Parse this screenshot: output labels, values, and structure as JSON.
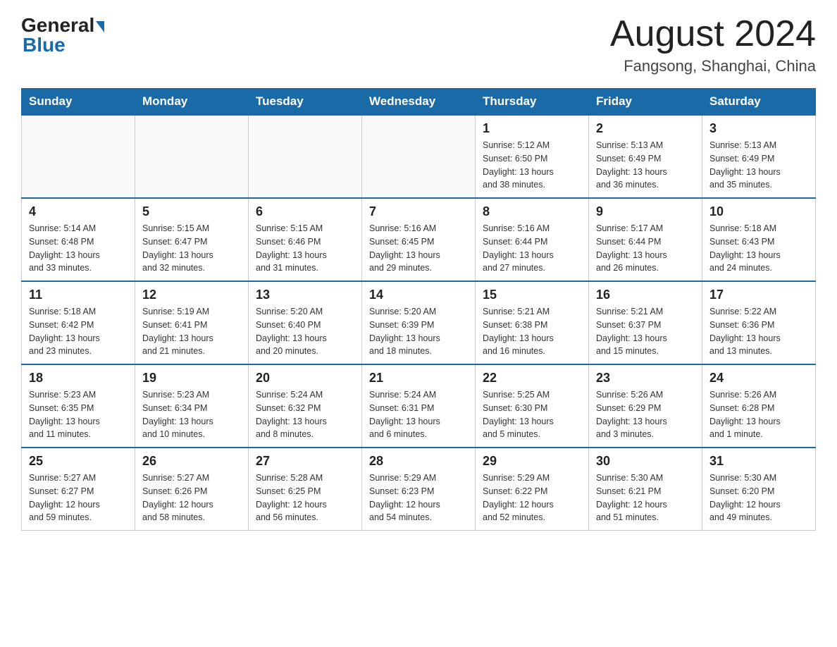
{
  "header": {
    "logo_general": "General",
    "logo_blue": "Blue",
    "month_title": "August 2024",
    "location": "Fangsong, Shanghai, China"
  },
  "days_of_week": [
    "Sunday",
    "Monday",
    "Tuesday",
    "Wednesday",
    "Thursday",
    "Friday",
    "Saturday"
  ],
  "weeks": [
    [
      {
        "day": "",
        "info": ""
      },
      {
        "day": "",
        "info": ""
      },
      {
        "day": "",
        "info": ""
      },
      {
        "day": "",
        "info": ""
      },
      {
        "day": "1",
        "info": "Sunrise: 5:12 AM\nSunset: 6:50 PM\nDaylight: 13 hours\nand 38 minutes."
      },
      {
        "day": "2",
        "info": "Sunrise: 5:13 AM\nSunset: 6:49 PM\nDaylight: 13 hours\nand 36 minutes."
      },
      {
        "day": "3",
        "info": "Sunrise: 5:13 AM\nSunset: 6:49 PM\nDaylight: 13 hours\nand 35 minutes."
      }
    ],
    [
      {
        "day": "4",
        "info": "Sunrise: 5:14 AM\nSunset: 6:48 PM\nDaylight: 13 hours\nand 33 minutes."
      },
      {
        "day": "5",
        "info": "Sunrise: 5:15 AM\nSunset: 6:47 PM\nDaylight: 13 hours\nand 32 minutes."
      },
      {
        "day": "6",
        "info": "Sunrise: 5:15 AM\nSunset: 6:46 PM\nDaylight: 13 hours\nand 31 minutes."
      },
      {
        "day": "7",
        "info": "Sunrise: 5:16 AM\nSunset: 6:45 PM\nDaylight: 13 hours\nand 29 minutes."
      },
      {
        "day": "8",
        "info": "Sunrise: 5:16 AM\nSunset: 6:44 PM\nDaylight: 13 hours\nand 27 minutes."
      },
      {
        "day": "9",
        "info": "Sunrise: 5:17 AM\nSunset: 6:44 PM\nDaylight: 13 hours\nand 26 minutes."
      },
      {
        "day": "10",
        "info": "Sunrise: 5:18 AM\nSunset: 6:43 PM\nDaylight: 13 hours\nand 24 minutes."
      }
    ],
    [
      {
        "day": "11",
        "info": "Sunrise: 5:18 AM\nSunset: 6:42 PM\nDaylight: 13 hours\nand 23 minutes."
      },
      {
        "day": "12",
        "info": "Sunrise: 5:19 AM\nSunset: 6:41 PM\nDaylight: 13 hours\nand 21 minutes."
      },
      {
        "day": "13",
        "info": "Sunrise: 5:20 AM\nSunset: 6:40 PM\nDaylight: 13 hours\nand 20 minutes."
      },
      {
        "day": "14",
        "info": "Sunrise: 5:20 AM\nSunset: 6:39 PM\nDaylight: 13 hours\nand 18 minutes."
      },
      {
        "day": "15",
        "info": "Sunrise: 5:21 AM\nSunset: 6:38 PM\nDaylight: 13 hours\nand 16 minutes."
      },
      {
        "day": "16",
        "info": "Sunrise: 5:21 AM\nSunset: 6:37 PM\nDaylight: 13 hours\nand 15 minutes."
      },
      {
        "day": "17",
        "info": "Sunrise: 5:22 AM\nSunset: 6:36 PM\nDaylight: 13 hours\nand 13 minutes."
      }
    ],
    [
      {
        "day": "18",
        "info": "Sunrise: 5:23 AM\nSunset: 6:35 PM\nDaylight: 13 hours\nand 11 minutes."
      },
      {
        "day": "19",
        "info": "Sunrise: 5:23 AM\nSunset: 6:34 PM\nDaylight: 13 hours\nand 10 minutes."
      },
      {
        "day": "20",
        "info": "Sunrise: 5:24 AM\nSunset: 6:32 PM\nDaylight: 13 hours\nand 8 minutes."
      },
      {
        "day": "21",
        "info": "Sunrise: 5:24 AM\nSunset: 6:31 PM\nDaylight: 13 hours\nand 6 minutes."
      },
      {
        "day": "22",
        "info": "Sunrise: 5:25 AM\nSunset: 6:30 PM\nDaylight: 13 hours\nand 5 minutes."
      },
      {
        "day": "23",
        "info": "Sunrise: 5:26 AM\nSunset: 6:29 PM\nDaylight: 13 hours\nand 3 minutes."
      },
      {
        "day": "24",
        "info": "Sunrise: 5:26 AM\nSunset: 6:28 PM\nDaylight: 13 hours\nand 1 minute."
      }
    ],
    [
      {
        "day": "25",
        "info": "Sunrise: 5:27 AM\nSunset: 6:27 PM\nDaylight: 12 hours\nand 59 minutes."
      },
      {
        "day": "26",
        "info": "Sunrise: 5:27 AM\nSunset: 6:26 PM\nDaylight: 12 hours\nand 58 minutes."
      },
      {
        "day": "27",
        "info": "Sunrise: 5:28 AM\nSunset: 6:25 PM\nDaylight: 12 hours\nand 56 minutes."
      },
      {
        "day": "28",
        "info": "Sunrise: 5:29 AM\nSunset: 6:23 PM\nDaylight: 12 hours\nand 54 minutes."
      },
      {
        "day": "29",
        "info": "Sunrise: 5:29 AM\nSunset: 6:22 PM\nDaylight: 12 hours\nand 52 minutes."
      },
      {
        "day": "30",
        "info": "Sunrise: 5:30 AM\nSunset: 6:21 PM\nDaylight: 12 hours\nand 51 minutes."
      },
      {
        "day": "31",
        "info": "Sunrise: 5:30 AM\nSunset: 6:20 PM\nDaylight: 12 hours\nand 49 minutes."
      }
    ]
  ]
}
